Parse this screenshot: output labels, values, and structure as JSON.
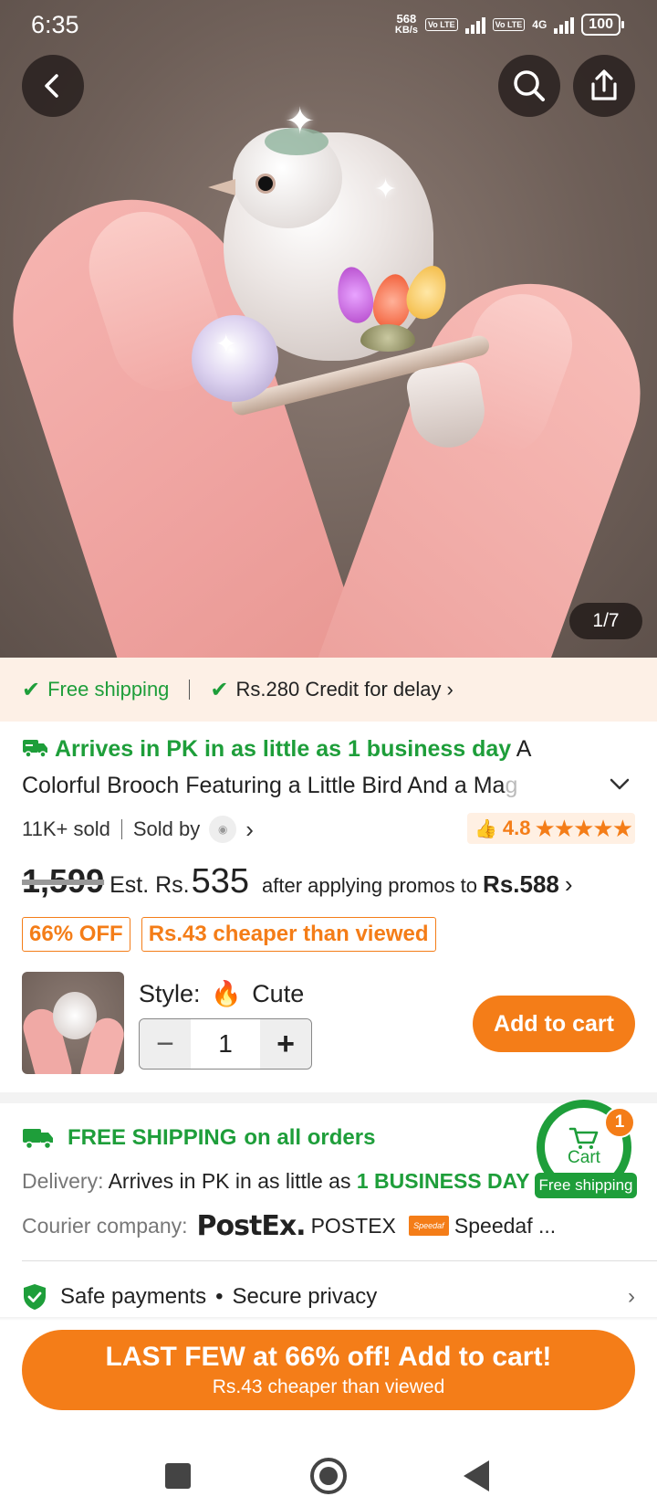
{
  "status_bar": {
    "time": "6:35",
    "speed_value": "568",
    "speed_unit": "KB/s",
    "volte1": "Vo LTE",
    "volte2": "Vo LTE",
    "network": "4G",
    "battery": "100"
  },
  "gallery": {
    "counter": "1/7"
  },
  "shipping_banner": {
    "free_shipping": "Free shipping",
    "credit": "Rs.280 Credit for delay"
  },
  "product": {
    "arrives": "Arrives in PK in as little as 1 business day",
    "title_main": "A Colorful Brooch Featuring a Little Bird And a Ma",
    "title_faded": "g",
    "sold": "11K+ sold",
    "sold_by": "Sold by",
    "rating": "4.8",
    "stars": "★★★★★"
  },
  "price": {
    "original": "1,599",
    "est_label": "Est. Rs.",
    "est_value": "535",
    "after_label": "after applying promos to",
    "after_value": "Rs.588"
  },
  "badges": {
    "discount": "66% OFF",
    "cheaper": "Rs.43 cheaper than viewed"
  },
  "purchase": {
    "style_label": "Style:",
    "style_value": "Cute",
    "quantity": "1",
    "minus": "−",
    "plus": "+",
    "add_to_cart": "Add to cart"
  },
  "shipping": {
    "free_label": "FREE SHIPPING",
    "free_suffix": "on all orders",
    "delivery_label": "Delivery:",
    "delivery_text": "Arrives in PK in as little as",
    "delivery_bold": "1 BUSINESS DAY",
    "courier_label": "Courier company:",
    "postex_logo": "PostEx.",
    "postex_name": "POSTEX",
    "speedaf_logo": "Speedaf",
    "speedaf_name": "Speedaf ..."
  },
  "cart_float": {
    "label": "Cart",
    "count": "1",
    "free_shipping": "Free shipping"
  },
  "safety": {
    "payments": "Safe payments",
    "dot": "•",
    "privacy": "Secure privacy"
  },
  "cta": {
    "main": "LAST FEW at 66% off! Add to cart!",
    "sub": "Rs.43 cheaper than viewed"
  },
  "colors": {
    "accent": "#f47d18",
    "green": "#1e9e3a",
    "banner_bg": "#fdf0e6"
  }
}
